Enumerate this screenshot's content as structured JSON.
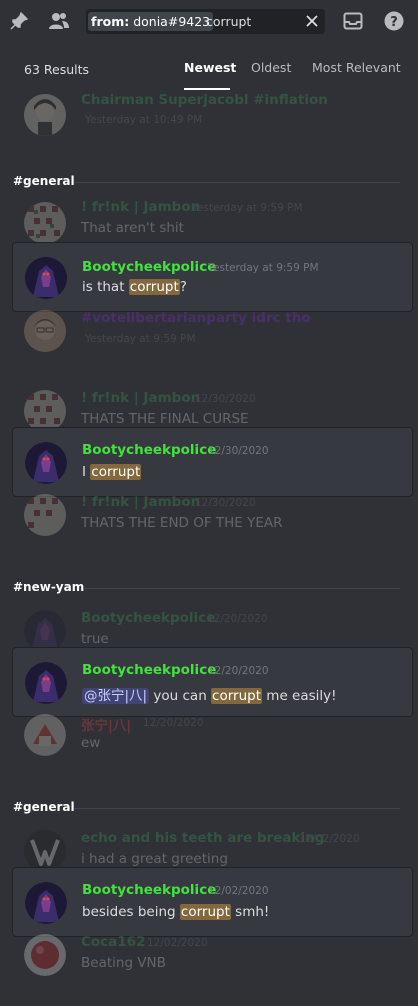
{
  "toolbar": {
    "icons": [
      "pin-icon",
      "members-icon",
      "inbox-icon",
      "help-icon"
    ],
    "search": {
      "filter_label": "from:",
      "filter_value": "donia#9423",
      "query": "corrupt"
    }
  },
  "results": {
    "count_label": "63 Results",
    "sort_options": [
      "Newest",
      "Oldest",
      "Most Relevant"
    ],
    "active_sort": "Newest"
  },
  "colors": {
    "bootycheek": "#43e23d",
    "frink": "#3ba55c",
    "jacob": "#3ba55c",
    "votelib": "#8a2be2",
    "zhang": "#ed4245",
    "echo": "#3ba55c",
    "coca": "#3ba55c",
    "highlight": "#82683c"
  },
  "groups": [
    {
      "top_context": {
        "name": "Chairman Superjacobl #inflation",
        "time": "Yesterday at 10:49 PM"
      }
    },
    {
      "channel": "#general",
      "before": {
        "name": "! fr!nk | Jambon",
        "time": "Yesterday at 9:59 PM",
        "text": "That aren't shit"
      },
      "hit": {
        "name": "Bootycheekpolice",
        "time": "Yesterday at 9:59 PM",
        "text_before": "is that ",
        "match": "corrupt",
        "text_after": "?"
      },
      "after": {
        "name": "#votelibertarianparty idrc tho",
        "time": "Yesterday at 9:59 PM"
      }
    },
    {
      "before": {
        "name": "! fr!nk | Jambon",
        "time": "12/30/2020",
        "text": "THATS THE FINAL CURSE"
      },
      "hit": {
        "name": "Bootycheekpolice",
        "time": "12/30/2020",
        "text_before": "I ",
        "match": "corrupt",
        "text_after": ""
      },
      "after": {
        "name": "! fr!nk | Jambon",
        "time": "12/30/2020",
        "text": "THATS THE END OF THE YEAR"
      }
    },
    {
      "channel": "#new-yam",
      "before": {
        "name": "Bootycheekpolice",
        "time": "12/20/2020",
        "text": "true"
      },
      "hit": {
        "name": "Bootycheekpolice",
        "time": "12/20/2020",
        "mention": "@张宁|八|",
        "text_before": " you can ",
        "match": "corrupt",
        "text_after": " me easily!"
      },
      "after": {
        "name": "张宁|八|",
        "time": "12/20/2020",
        "text": "ew"
      }
    },
    {
      "channel": "#general",
      "before": {
        "name": "echo and his teeth are breaking",
        "time": "12/02/2020",
        "text": "i had a great greeting"
      },
      "hit": {
        "name": "Bootycheekpolice",
        "time": "12/02/2020",
        "text_before": "besides being ",
        "match": "corrupt",
        "text_after": " smh!"
      },
      "after": {
        "name": "Coca162",
        "time": "12/02/2020",
        "text": "Beating VNB"
      }
    }
  ]
}
